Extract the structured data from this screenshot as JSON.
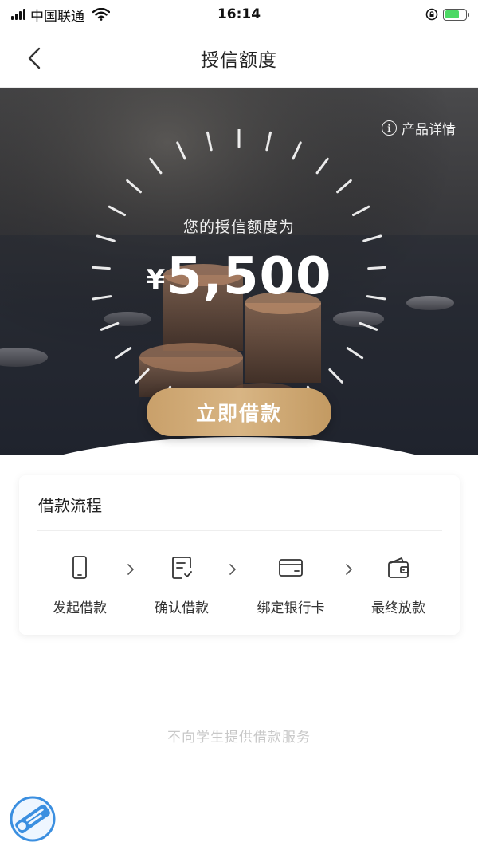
{
  "status_bar": {
    "carrier": "中国联通",
    "time": "16:14"
  },
  "nav": {
    "title": "授信额度",
    "back_icon": "chevron-left-icon"
  },
  "hero": {
    "product_detail_label": "产品详情",
    "credit_label": "您的授信额度为",
    "currency_symbol": "¥",
    "credit_amount": "5,500",
    "borrow_button_label": "立即借款"
  },
  "process": {
    "title": "借款流程",
    "steps": [
      {
        "label": "发起借款",
        "icon": "phone-icon"
      },
      {
        "label": "确认借款",
        "icon": "confirm-document-icon"
      },
      {
        "label": "绑定银行卡",
        "icon": "bank-card-icon"
      },
      {
        "label": "最终放款",
        "icon": "wallet-icon"
      }
    ]
  },
  "footer_note": "不向学生提供借款服务",
  "colors": {
    "accent_gold": "#c9a06a",
    "battery_green": "#4cd964",
    "muted_text": "#c8c8c8"
  }
}
